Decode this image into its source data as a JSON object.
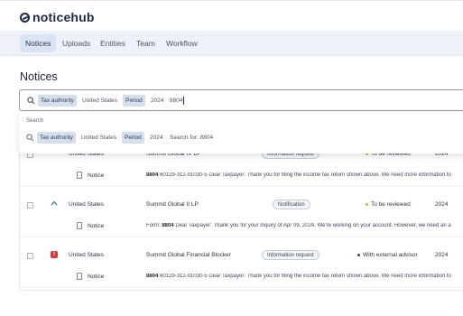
{
  "app": {
    "name": "noticehub"
  },
  "nav": {
    "items": [
      "Notices",
      "Uploads",
      "Entities",
      "Team",
      "Workflow"
    ],
    "active": "Notices"
  },
  "page": {
    "title": "Notices"
  },
  "search": {
    "chips": [
      {
        "key": "Tax authority",
        "value": "United States"
      },
      {
        "key": "Period",
        "value": "2024"
      }
    ],
    "query": "8804"
  },
  "dropdown": {
    "heading": "Search",
    "suggestion": {
      "chips": [
        {
          "key": "Tax authority",
          "value": "United States"
        },
        {
          "key": "Period",
          "value": "2024"
        }
      ],
      "search_for": "Search for: 8804"
    }
  },
  "rows": [
    {
      "authority": "United States",
      "entity": "Summit Global IV LP",
      "type": "Information request",
      "status": "To be reviewed",
      "status_color": "#e5a823",
      "period": "2024",
      "doc_label": "Notice",
      "snippet_bold": "8804",
      "snippet_rest": " 60129-312-01030-5 Dear Taxpayer: Thank you for filing the income tax return shown above. We need more information to"
    },
    {
      "authority": "United States",
      "entity": "Summit Global II LP",
      "type": "Notification",
      "status": "To be reviewed",
      "status_color": "#e5a823",
      "period": "2024",
      "priority_icon": "chevron-up-icon",
      "doc_label": "Notice",
      "snippet_lead": "Form: ",
      "snippet_bold": "8804",
      "snippet_rest": " Dear Taxpayer: Thank you for your inquiry of Apr 09, 2024. We're working on your account. However, we need an a"
    },
    {
      "authority": "United States",
      "entity": "Summit Global Financial Blocker",
      "type": "Information request",
      "status": "With external advisor",
      "status_color": "#2d3d8f",
      "period": "2024",
      "priority_icon": "alert-icon",
      "doc_label": "Notice",
      "snippet_bold": "8804",
      "snippet_rest": " 60129-312-01030-5 Dear Taxpayer: Thank you for filing the income tax return shown above. We need more information to"
    }
  ],
  "colors": {
    "accent": "#1d2940",
    "chip_bg": "#d5deec",
    "nav_bg": "#eef2f8",
    "alert": "#d33b3b"
  }
}
